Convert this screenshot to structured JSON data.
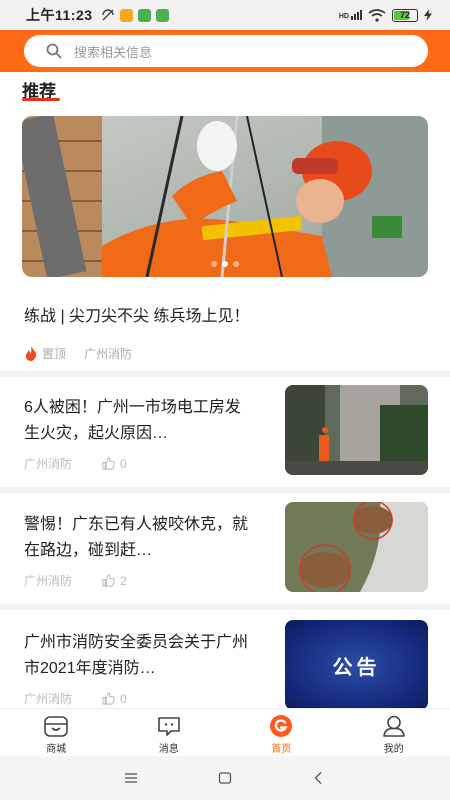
{
  "status_bar": {
    "time": "上午11:23",
    "signal": "HD",
    "battery": "72",
    "battery_level": 0.72
  },
  "search": {
    "placeholder": "搜索相关信息"
  },
  "section": {
    "title": "推荐"
  },
  "featured": {
    "title": "练战 | 尖刀尖不尖 练兵场上见！",
    "pin_label": "置顶",
    "source": "广州消防",
    "carousel_pages": 3,
    "carousel_active": 2
  },
  "articles": [
    {
      "title": "6人被困！广州一市场电工房发生火灾，起火原因…",
      "source": "广州消防",
      "likes": "0",
      "thumb": "fire-smoke-scene"
    },
    {
      "title": "警惕！广东已有人被咬休克，就在路边，碰到赶…",
      "source": "广州消防",
      "likes": "2",
      "thumb": "fire-ant-nest"
    },
    {
      "title": "广州市消防安全委员会关于广州市2021年度消防…",
      "source": "广州消防",
      "likes": "0",
      "thumb_text": "公告"
    }
  ],
  "bottom_nav": {
    "items": [
      {
        "label": "商城",
        "icon": "shop-icon"
      },
      {
        "label": "消息",
        "icon": "message-icon"
      },
      {
        "label": "首页",
        "icon": "home-logo-icon",
        "active": true
      },
      {
        "label": "我的",
        "icon": "profile-icon"
      }
    ]
  },
  "colors": {
    "brand": "#ff6a14",
    "accent_red": "#e8321c"
  }
}
